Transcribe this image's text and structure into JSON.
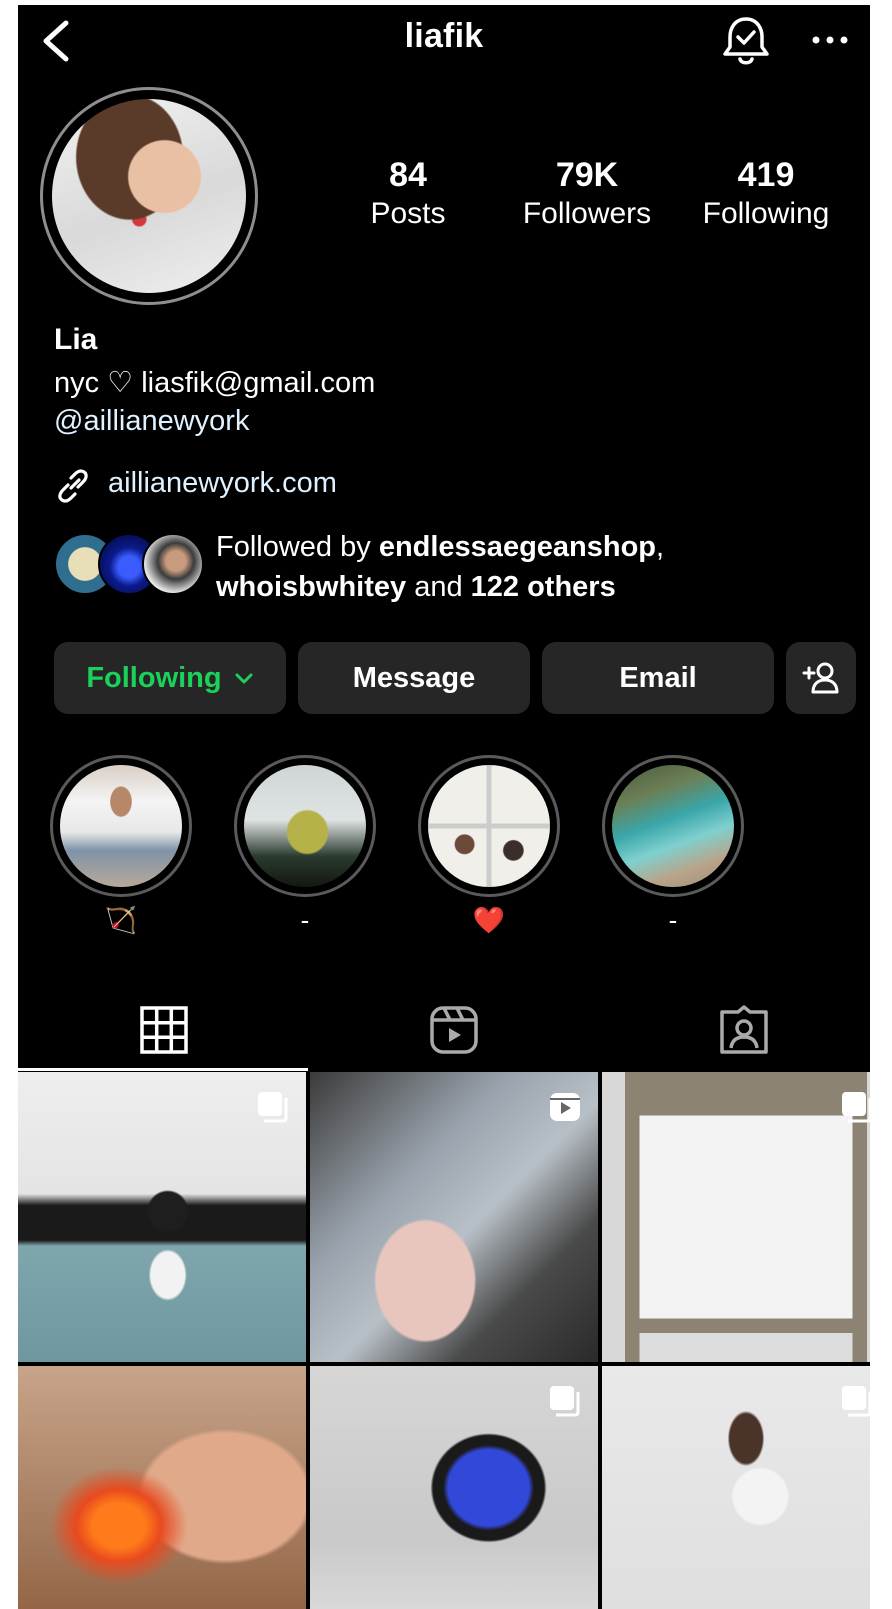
{
  "header": {
    "username": "liafik"
  },
  "stats": [
    {
      "value": "84",
      "label": "Posts"
    },
    {
      "value": "79K",
      "label": "Followers"
    },
    {
      "value": "419",
      "label": "Following"
    }
  ],
  "bio": {
    "name": "Lia",
    "line1": "nyc ♡ liasfik@gmail.com",
    "tag": "@aillianewyork",
    "link": "aillianewyork.com"
  },
  "followed_by": {
    "prefix": "Followed by ",
    "user1": "endlessaegeanshop",
    "comma": ",",
    "user2": "whoisbwhitey",
    "middle": " and ",
    "others": "122 others"
  },
  "buttons": {
    "following": "Following",
    "message": "Message",
    "email": "Email"
  },
  "highlights": [
    {
      "label": "🏹"
    },
    {
      "label": "-"
    },
    {
      "label": "❤️"
    },
    {
      "label": "-"
    }
  ],
  "colors": {
    "following_green": "#1bd15a",
    "button_bg": "#262626",
    "link_blue": "#e0f1ff"
  },
  "icons": {
    "back": "chevron-left-icon",
    "bell": "bell-check-icon",
    "more": "more-horizontal-icon",
    "link": "link-icon",
    "add_user": "add-user-icon",
    "grid": "grid-icon",
    "reels": "reels-icon",
    "tagged": "tagged-icon"
  }
}
